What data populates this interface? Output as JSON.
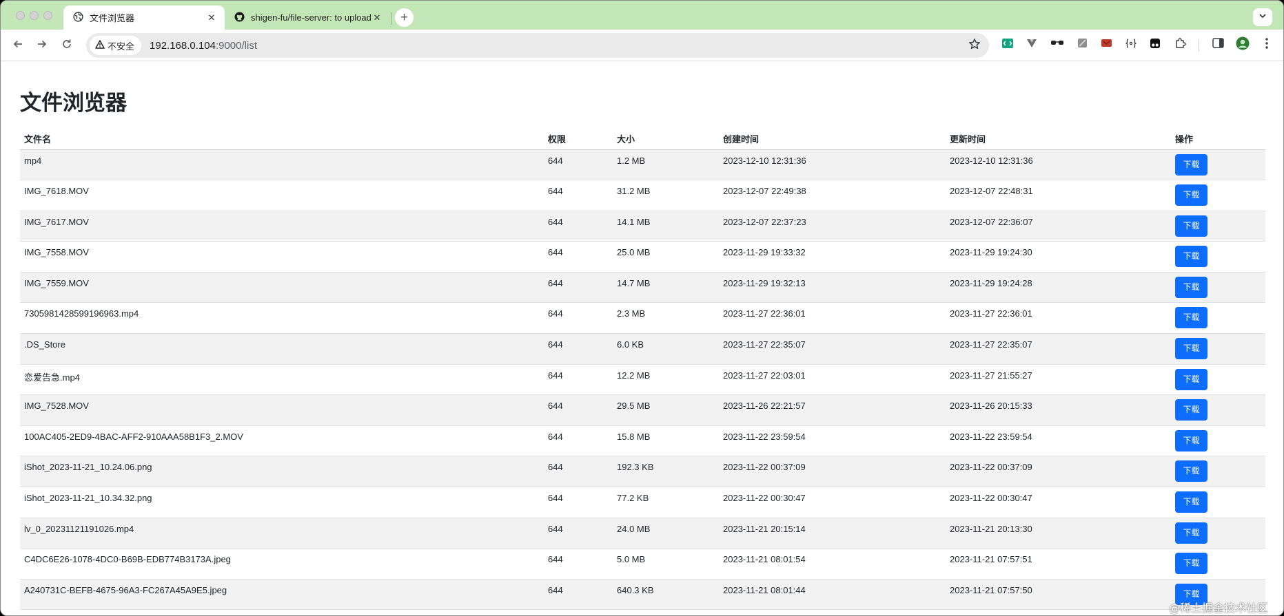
{
  "browser": {
    "tabs": [
      {
        "title": "文件浏览器",
        "active": true
      },
      {
        "title": "shigen-fu/file-server: to upload",
        "active": false
      }
    ],
    "security_label": "不安全",
    "url_host": "192.168.0.104",
    "url_rest": ":9000/list",
    "new_tab_label": "+",
    "tab_close": "✕"
  },
  "page": {
    "title": "文件浏览器",
    "columns": [
      "文件名",
      "权限",
      "大小",
      "创建时间",
      "更新时间",
      "操作"
    ],
    "download_label": "下载",
    "rows": [
      {
        "name": "mp4",
        "perm": "644",
        "size": "1.2 MB",
        "ctime": "2023-12-10 12:31:36",
        "mtime": "2023-12-10 12:31:36"
      },
      {
        "name": "IMG_7618.MOV",
        "perm": "644",
        "size": "31.2 MB",
        "ctime": "2023-12-07 22:49:38",
        "mtime": "2023-12-07 22:48:31"
      },
      {
        "name": "IMG_7617.MOV",
        "perm": "644",
        "size": "14.1 MB",
        "ctime": "2023-12-07 22:37:23",
        "mtime": "2023-12-07 22:36:07"
      },
      {
        "name": "IMG_7558.MOV",
        "perm": "644",
        "size": "25.0 MB",
        "ctime": "2023-11-29 19:33:32",
        "mtime": "2023-11-29 19:24:30"
      },
      {
        "name": "IMG_7559.MOV",
        "perm": "644",
        "size": "14.7 MB",
        "ctime": "2023-11-29 19:32:13",
        "mtime": "2023-11-29 19:24:28"
      },
      {
        "name": "7305981428599196963.mp4",
        "perm": "644",
        "size": "2.3 MB",
        "ctime": "2023-11-27 22:36:01",
        "mtime": "2023-11-27 22:36:01"
      },
      {
        "name": ".DS_Store",
        "perm": "644",
        "size": "6.0 KB",
        "ctime": "2023-11-27 22:35:07",
        "mtime": "2023-11-27 22:35:07"
      },
      {
        "name": "恋爱告急.mp4",
        "perm": "644",
        "size": "12.2 MB",
        "ctime": "2023-11-27 22:03:01",
        "mtime": "2023-11-27 21:55:27"
      },
      {
        "name": "IMG_7528.MOV",
        "perm": "644",
        "size": "29.5 MB",
        "ctime": "2023-11-26 22:21:57",
        "mtime": "2023-11-26 20:15:33"
      },
      {
        "name": "100AC405-2ED9-4BAC-AFF2-910AAA58B1F3_2.MOV",
        "perm": "644",
        "size": "15.8 MB",
        "ctime": "2023-11-22 23:59:54",
        "mtime": "2023-11-22 23:59:54"
      },
      {
        "name": "iShot_2023-11-21_10.24.06.png",
        "perm": "644",
        "size": "192.3 KB",
        "ctime": "2023-11-22 00:37:09",
        "mtime": "2023-11-22 00:37:09"
      },
      {
        "name": "iShot_2023-11-21_10.34.32.png",
        "perm": "644",
        "size": "77.2 KB",
        "ctime": "2023-11-22 00:30:47",
        "mtime": "2023-11-22 00:30:47"
      },
      {
        "name": "lv_0_20231121191026.mp4",
        "perm": "644",
        "size": "24.0 MB",
        "ctime": "2023-11-21 20:15:14",
        "mtime": "2023-11-21 20:13:30"
      },
      {
        "name": "C4DC6E26-1078-4DC0-B69B-EDB774B3173A.jpeg",
        "perm": "644",
        "size": "5.0 MB",
        "ctime": "2023-11-21 08:01:54",
        "mtime": "2023-11-21 07:57:51"
      },
      {
        "name": "A240731C-BEFB-4675-96A3-FC267A45A9E5.jpeg",
        "perm": "644",
        "size": "640.3 KB",
        "ctime": "2023-11-21 08:01:44",
        "mtime": "2023-11-21 07:57:50"
      }
    ]
  },
  "watermark": "@稀土掘金技术社区",
  "colors": {
    "tabstrip": "#c4e7b8",
    "primary_button": "#0d6efd",
    "stripe": "#f2f2f2"
  }
}
